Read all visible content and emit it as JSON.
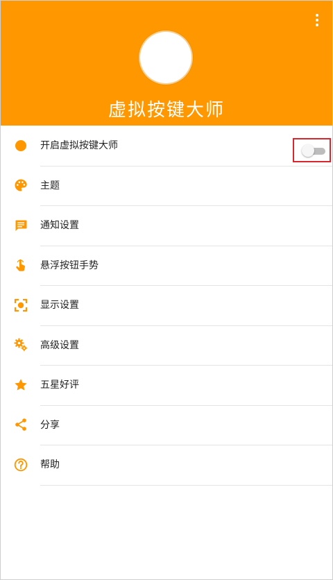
{
  "app": {
    "title": "虚拟按键大师",
    "accent_color": "#ff9800"
  },
  "toolbar": {
    "overflow_icon": "more-vert-icon"
  },
  "toggle": {
    "state": "off"
  },
  "menu": {
    "items": [
      {
        "label": "开启虚拟按键大师",
        "icon": "circle-dot-icon"
      },
      {
        "label": "主题",
        "icon": "palette-icon"
      },
      {
        "label": "通知设置",
        "icon": "message-icon"
      },
      {
        "label": "悬浮按钮手势",
        "icon": "touch-gesture-icon"
      },
      {
        "label": "显示设置",
        "icon": "screen-focus-icon"
      },
      {
        "label": "高级设置",
        "icon": "gears-icon"
      },
      {
        "label": "五星好评",
        "icon": "star-icon"
      },
      {
        "label": "分享",
        "icon": "share-icon"
      },
      {
        "label": "帮助",
        "icon": "help-icon"
      }
    ]
  }
}
